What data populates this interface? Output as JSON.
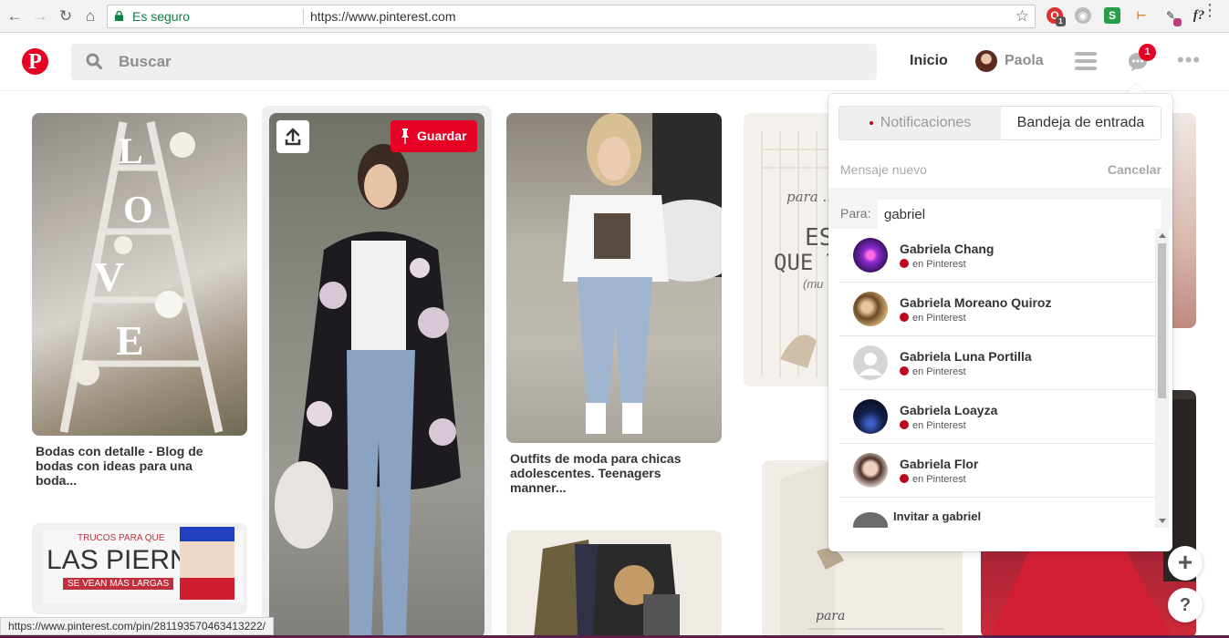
{
  "browser": {
    "secure_label": "Es seguro",
    "url": "https://www.pinterest.com",
    "status_url": "https://www.pinterest.com/pin/281193570463413222/",
    "ext_badge": "1"
  },
  "header": {
    "search_placeholder": "Buscar",
    "home_label": "Inicio",
    "user_name": "Paola",
    "notification_count": "1"
  },
  "pins": {
    "pin1_title": "Bodas con detalle - Blog de bodas con ideas para una boda...",
    "pin2_title": "Outfits de moda para chicas adolescentes. Teenagers manner...",
    "save_label": "Guardar",
    "piernas_banner_top": "TRUCOS PARA QUE",
    "piernas_banner_main": "LAS PIERNAS",
    "piernas_banner_sub": "SE VEAN MÁS LARGAS",
    "card_text_1": "para ...",
    "card_text_2": "ES",
    "card_text_3": "QUE T",
    "card_text_4": "(mu",
    "card_text_5": "para"
  },
  "panel": {
    "tab_notifications": "Notificaciones",
    "tab_inbox": "Bandeja de entrada",
    "new_message": "Mensaje nuevo",
    "cancel": "Cancelar",
    "to_label": "Para:",
    "to_value": "gabriel",
    "results": [
      {
        "name": "Gabriela Chang",
        "source": "en Pinterest"
      },
      {
        "name": "Gabriela Moreano Quiroz",
        "source": "en Pinterest"
      },
      {
        "name": "Gabriela Luna Portilla",
        "source": "en Pinterest"
      },
      {
        "name": "Gabriela Loayza",
        "source": "en Pinterest"
      },
      {
        "name": "Gabriela Flor",
        "source": "en Pinterest"
      }
    ],
    "invite": "Invitar a gabriel"
  },
  "fabs": {
    "plus": "+",
    "help": "?"
  },
  "colors": {
    "brand": "#e60023",
    "secure": "#0b8043"
  }
}
